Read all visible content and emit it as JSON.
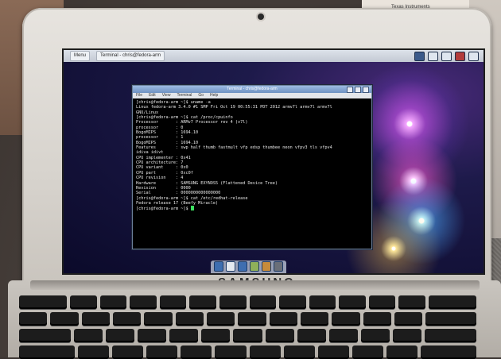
{
  "laptop": {
    "brand": "SAMSUNG"
  },
  "taskbar": {
    "items": [
      "Menu",
      "Terminal - chris@fedora-arm"
    ]
  },
  "terminal": {
    "title": "Terminal - chris@fedora-arm",
    "menu": [
      "File",
      "Edit",
      "View",
      "Terminal",
      "Go",
      "Help"
    ],
    "lines": [
      "[chris@fedora-arm ~]$ uname -a",
      "Linux fedora-arm 3.4.0 #1 SMP Fri Oct 19 00:55:31 PDT 2012 armv7l armv7l armv7l",
      "GNU/Linux",
      "[chris@fedora-arm ~]$ cat /proc/cpuinfo",
      "Processor       : ARMv7 Processor rev 4 (v7l)",
      "processor       : 0",
      "BogoMIPS        : 1694.10",
      "",
      "processor       : 1",
      "BogoMIPS        : 1694.10",
      "",
      "Features        : swp half thumb fastmult vfp edsp thumbee neon vfpv3 tls vfpv4",
      "idiva idivt",
      "CPU implementer : 0x41",
      "CPU architecture: 7",
      "CPU variant     : 0x0",
      "CPU part        : 0xc0f",
      "CPU revision    : 4",
      "",
      "Hardware        : SAMSUNG EXYNOS5 (Flattened Device Tree)",
      "Revision        : 0000",
      "Serial          : 0000000000000000",
      "[chris@fedora-arm ~]$ cat /etc/redhat-release",
      "Fedora release 17 (Beefy Miracle)",
      "[chris@fedora-arm ~]$ "
    ]
  },
  "background_box": {
    "label": "Texas Instruments"
  }
}
